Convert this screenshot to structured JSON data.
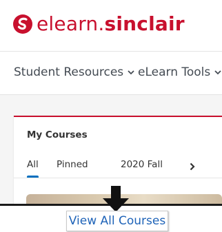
{
  "header": {
    "logo_light": "elearn.",
    "logo_bold": "sinclair",
    "brand_color": "#c8102e"
  },
  "nav": {
    "items": [
      {
        "label": "Student Resources",
        "icon": "chevron-down-icon"
      },
      {
        "label": "eLearn Tools",
        "icon": "chevron-down-icon"
      }
    ]
  },
  "widget": {
    "title": "My Courses",
    "tabs": [
      {
        "label": "All",
        "selected": true
      },
      {
        "label": "Pinned",
        "selected": false
      },
      {
        "label": "2020 Fall",
        "selected": false
      }
    ],
    "next_icon": "chevron-right-icon",
    "accent_color": "#006fbf"
  },
  "callout": {
    "button_label": "View All Courses",
    "pointer_icon": "arrow-down-icon"
  }
}
